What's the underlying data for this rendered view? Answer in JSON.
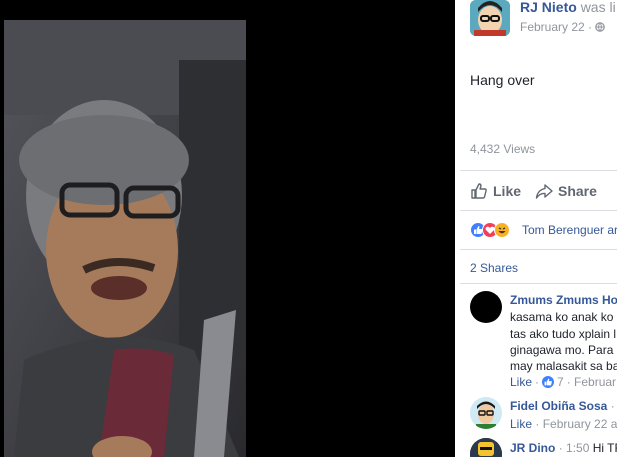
{
  "post": {
    "author": "RJ Nieto",
    "status_text": "was li",
    "date": "February 22",
    "dot": "·",
    "message": "Hang over",
    "views": "4,432 Views"
  },
  "actions": {
    "like_label": "Like",
    "share_label": "Share"
  },
  "reactions": {
    "names": "Tom Berenguer ar",
    "shares": "2 Shares"
  },
  "comments": [
    {
      "author": "Zmums Zmums Ho",
      "lines": [
        "kasama ko anak ko",
        "tas ako tudo xplain l",
        "ginagawa mo. Para",
        "may malasakit sa ba"
      ],
      "like_label": "Like",
      "dot": "·",
      "like_count": "7",
      "date": "· Februar"
    },
    {
      "author": "Fidel Obiña Sosa",
      "suffix": "·",
      "like_label": "Like",
      "date": "· February 22 a"
    },
    {
      "author": "JR Dino",
      "time": "· 1:50",
      "text": "Hi TF"
    }
  ],
  "colors": {
    "link_blue": "#365899",
    "meta_grey": "#90949c",
    "like_blue": "#4080ff",
    "love_red": "#f33e58",
    "haha_yellow": "#f7b125"
  },
  "icons": [
    "globe-icon",
    "like-thumb-icon",
    "share-arrow-icon",
    "like-reaction-icon",
    "love-reaction-icon",
    "haha-reaction-icon"
  ]
}
